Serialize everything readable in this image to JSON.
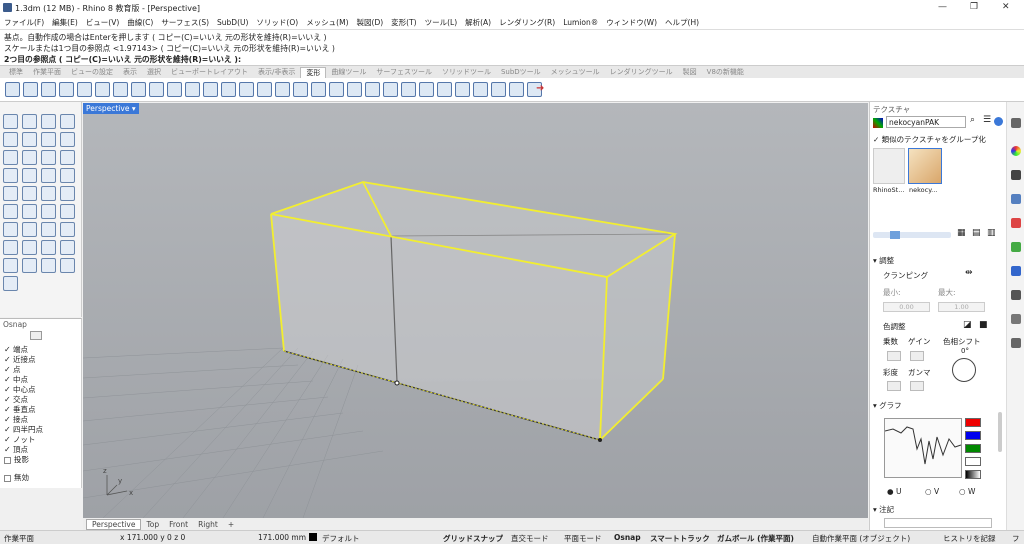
{
  "window": {
    "title": "1.3dm (12 MB) - Rhino 8 教育版 - [Perspective]",
    "minimize": "—",
    "maximize": "❐",
    "close": "✕"
  },
  "menu": [
    "ファイル(F)",
    "編集(E)",
    "ビュー(V)",
    "曲線(C)",
    "サーフェス(S)",
    "SubD(U)",
    "ソリッド(O)",
    "メッシュ(M)",
    "製図(D)",
    "変形(T)",
    "ツール(L)",
    "解析(A)",
    "レンダリング(R)",
    "Lumion®",
    "ウィンドウ(W)",
    "ヘルプ(H)"
  ],
  "command": {
    "line1": "基点。自動作成の場合はEnterを押します ( コピー(C)=いいえ  元の形状を維持(R)=いいえ )",
    "line2": "スケールまたは1つ目の参照点 <1.97143> ( コピー(C)=いいえ  元の形状を維持(R)=いいえ )",
    "line3": "2つ目の参照点 ( コピー(C)=いいえ  元の形状を維持(R)=いいえ ):"
  },
  "tabs": [
    "標準",
    "作業平面",
    "ビューの設定",
    "表示",
    "選択",
    "ビューポートレイアウト",
    "表示/非表示",
    "変形",
    "曲線ツール",
    "サーフェスツール",
    "ソリッドツール",
    "SubDツール",
    "メッシュツール",
    "レンダリングツール",
    "製図",
    "V8の新機能"
  ],
  "active_tab": "変形",
  "osnap": {
    "title": "Osnap",
    "items": [
      {
        "label": "端点",
        "checked": true
      },
      {
        "label": "近接点",
        "checked": true
      },
      {
        "label": "点",
        "checked": true
      },
      {
        "label": "中点",
        "checked": true
      },
      {
        "label": "中心点",
        "checked": true
      },
      {
        "label": "交点",
        "checked": true
      },
      {
        "label": "垂直点",
        "checked": true
      },
      {
        "label": "接点",
        "checked": true
      },
      {
        "label": "四半円点",
        "checked": true
      },
      {
        "label": "ノット",
        "checked": true
      },
      {
        "label": "頂点",
        "checked": true
      },
      {
        "label": "投影",
        "checked": false
      },
      {
        "label": "無効",
        "checked": false
      }
    ]
  },
  "viewport": {
    "label": "Perspective ▾",
    "tabs": [
      "Perspective",
      "Top",
      "Front",
      "Right",
      "+"
    ]
  },
  "status": {
    "cplane": "作業平面",
    "coords": "x 171.000  y 0  z 0",
    "dist": "171.000 mm",
    "layer": "デフォルト",
    "grid_snap": "グリッドスナップ",
    "ortho": "直交モード",
    "planar": "平面モード",
    "osnap": "Osnap",
    "smarttrack": "スマートトラック",
    "gumball": "ガムボール (作業平面)",
    "auto_cplane": "自動作業平面 (オブジェクト)",
    "history": "ヒストリを記録",
    "filter": "フ"
  },
  "texture_panel": {
    "title": "テクスチャ",
    "name": "nekocyanPAK",
    "group_label": "類似のテクスチャをグループ化",
    "thumb1": "RhinoSt...",
    "thumb2": "nekocy...",
    "adjust": "調整",
    "clamping": "クランピング",
    "min": "最小:",
    "max": "最大:",
    "min_val": "0.00",
    "max_val": "1.00",
    "color_adjust": "色調整",
    "multiply": "乗数",
    "gain": "ゲイン",
    "hue_shift": "色相シフト",
    "saturation": "彩度",
    "gamma": "ガンマ",
    "hue_deg": "0°",
    "graph": "グラフ",
    "u": "U",
    "v": "V",
    "w": "W",
    "notes": "注記"
  },
  "colors": {
    "accent": "#3b78d8",
    "box_edge": "#f2ee30",
    "viewport_bg": "#a6a9ae"
  }
}
